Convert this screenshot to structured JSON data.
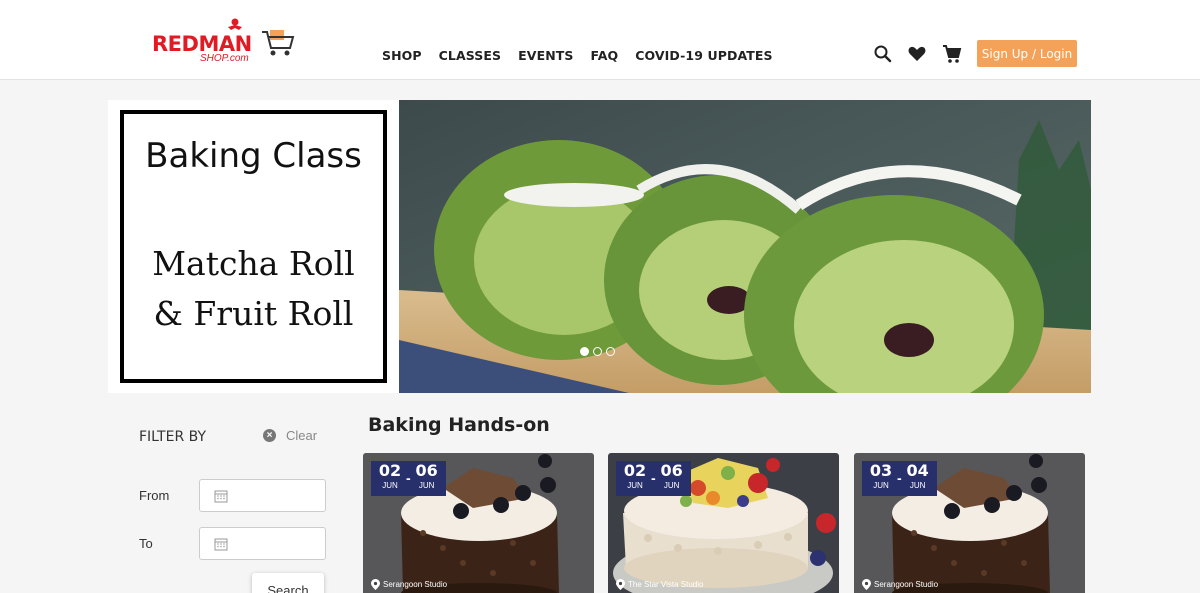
{
  "brand": {
    "name": "REDMAN",
    "sub": "SHOP.com",
    "color": "#e01b24"
  },
  "nav": [
    {
      "label": "SHOP"
    },
    {
      "label": "CLASSES"
    },
    {
      "label": "EVENTS"
    },
    {
      "label": "FAQ"
    },
    {
      "label": "COVID-19 UPDATES"
    }
  ],
  "header_icons": [
    "search-icon",
    "heart-icon",
    "cart-icon"
  ],
  "login": {
    "label": "Sign Up / Login",
    "color": "#f4a259"
  },
  "banner": {
    "title": "Baking Class",
    "sub1": "Matcha Roll",
    "sub2": "& Fruit Roll",
    "slide_count": 3,
    "active_slide": 1
  },
  "filter": {
    "title": "FILTER BY",
    "clear": "Clear",
    "from_label": "From",
    "to_label": "To",
    "search_label": "Search"
  },
  "section": {
    "title": "Baking Hands-on"
  },
  "cards": [
    {
      "day1": "02",
      "mon1": "JUN",
      "day2": "06",
      "mon2": "JUN",
      "venue": "Serangoon Studio",
      "image": "black-forest-cake"
    },
    {
      "day1": "02",
      "mon1": "JUN",
      "day2": "06",
      "mon2": "JUN",
      "venue": "The Star Vista Studio",
      "image": "fruit-cake"
    },
    {
      "day1": "03",
      "mon1": "JUN",
      "day2": "04",
      "mon2": "JUN",
      "venue": "Serangoon Studio",
      "image": "black-forest-cake"
    }
  ],
  "colors": {
    "badge": "#28306b",
    "background": "#f5f5f5"
  }
}
